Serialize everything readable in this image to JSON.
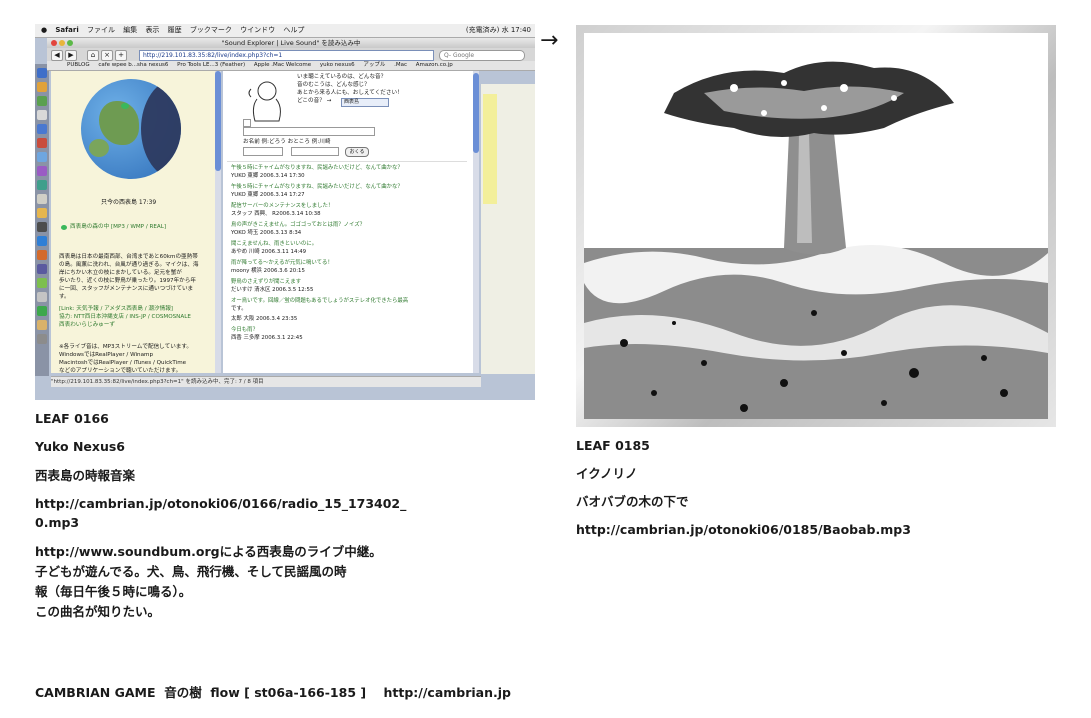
{
  "left_item": {
    "leaf_id": "LEAF 0166",
    "author": "Yuko Nexus6",
    "title": "西表島の時報音楽",
    "url_line1": "http://cambrian.jp/otonoki06/0166/radio_15_173402_",
    "url_line2": "0.mp3",
    "description": "http://www.soundbum.orgによる西表島のライブ中継。\n子どもが遊んでる。犬、鳥、飛行機、そして民謡風の時\n報（毎日午後５時に鳴る）。\nこの曲名が知りたい。"
  },
  "right_item": {
    "leaf_id": "LEAF 0185",
    "author": "イクノリノ",
    "title": "バオバブの木の下で",
    "url": "http://cambrian.jp/otonoki06/0185/Baobab.mp3"
  },
  "footer": "CAMBRIAN GAME  音の樹  flow [ st06a-166-185 ]    http://cambrian.jp",
  "arrow_glyph": "→",
  "screenshot": {
    "menubar": [
      "Safari",
      "ファイル",
      "編集",
      "表示",
      "履歴",
      "ブックマーク",
      "ウインドウ",
      "ヘルプ"
    ],
    "clock": "(充電済み)  水 17:40",
    "window_title": "\"Sound Explorer | Live Sound\" を読み込み中",
    "url": "http://219.101.83.35:82/live/index.php3?ch=1",
    "search_placeholder": "Q- Google",
    "bookmarks": [
      "PUBLOG",
      "cafe wpee b...sha nexus6",
      "Pro Tools LE...3 (Feather)",
      "Apple .Mac Welcome",
      "yuko nexus6",
      "アップル",
      ".Mac",
      "Amazon.co.jp"
    ],
    "left_pane": {
      "time": "只今の西表島  17:39",
      "stream_label": "西表島の森の中  [MP3 / WMP / REAL]",
      "body": "西表島は日本の最南西部、台湾まであと60kmの亜熱帯\nの島。風薫に洗われ、台風が通り過ぎる。マイクは、海\n岸にちかい木立の枝にまかしている。足元を蟹が\n歩いたり、近くの枝に野鳥が乗ったり。1997年から年\nに一回、スタッフがメンテナンスに通いつづけていま\nす。",
      "links": "[Link: 天気予報 / アメダス西表島 / 潮汐情報]\n協力: NTT西日本沖縄支店 / INS-JP / COSMOSNALE\n   西表わいらじみゅーず",
      "footer": "※各ライブ音は、MP3ストリームで配信しています。\nWindowsではRealPlayer / Winamp\nMacintoshではRealPlayer / iTunes / QuickTime\nなどのアプリケーションで聴いていただけます。"
    },
    "right_pane": {
      "question": "いま聴こえているのは、どんな音？\n音のむこうは、どんな感じ？\nあとから来る人にも、おしえてください！\nどこの音？ →",
      "select_value": "西表島",
      "form_labels": "お名前  例:どろう      おところ  例:川崎",
      "submit": "おくる",
      "messages": [
        {
          "text": "午後５時にチャイムがなりますね、民謡みたいだけど、なんて曲かな？",
          "green": true
        },
        {
          "text": "YUKO  東郷  2006.3.14 17:30",
          "green": false
        },
        {
          "text": "午後５時にチャイムがなりますね、民謡みたいだけど、なんて曲かな？",
          "green": true
        },
        {
          "text": "YUKO  東郷  2006.3.14 17:27",
          "green": false
        },
        {
          "text": "配信サーバーのメンテナンスをしました！",
          "green": true
        },
        {
          "text": "スタッフ  西興、  R2006.3.14 10:38",
          "green": false
        },
        {
          "text": "鳥の声がきこえません。ゴゴゴっておとは雨？ノイズ？",
          "green": true
        },
        {
          "text": "YOKO  埼玉  2006.3.13 8:34",
          "green": false
        },
        {
          "text": "聞こえませんね、雨きといいのに。",
          "green": true
        },
        {
          "text": "あやめ  川崎  2006.3.11 14:49",
          "green": false
        },
        {
          "text": "雨が降ってる～かえるが元気に鳴いてる！",
          "green": true
        },
        {
          "text": "moony  横浜  2006.3.6 20:15",
          "green": false
        },
        {
          "text": "野鳥のさえずりが聞こえます",
          "green": true
        },
        {
          "text": "だいすけ  清水区  2006.3.5 12:55",
          "green": false
        },
        {
          "text": "オー鳥いです。回線／蛍の問題もあるでしょうがステレオ化できたら最高",
          "green": true
        },
        {
          "text": "です。",
          "green": false
        },
        {
          "text": "太郎  大阪  2006.3.4 23:35",
          "green": false
        },
        {
          "text": "今日も雨？",
          "green": true
        },
        {
          "text": "西香  三多摩  2006.3.1 22:45",
          "green": false
        }
      ]
    },
    "status": "\"http://219.101.83.35:82/live/index.php3?ch=1\" を読み込み中、完了: 7 / 8 項目"
  }
}
